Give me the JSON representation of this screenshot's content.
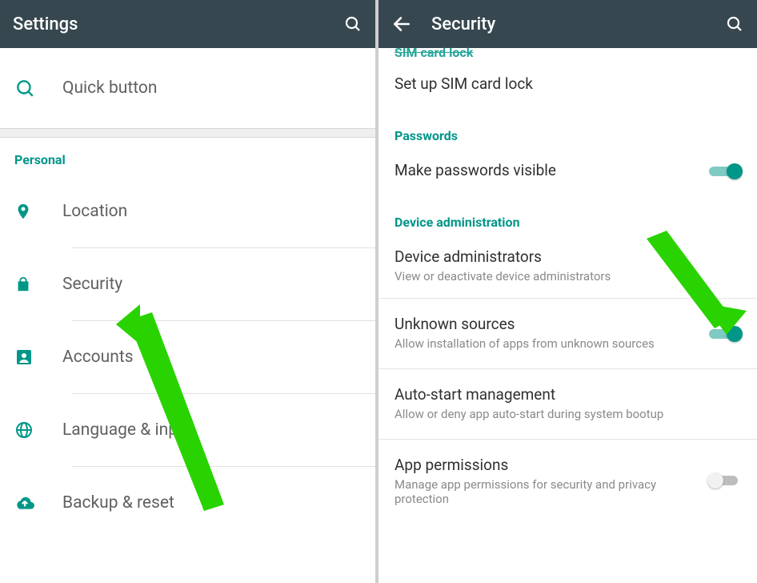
{
  "colors": {
    "accent": "#009688",
    "appbar": "#37474f",
    "arrow": "#29d301"
  },
  "left": {
    "title": "Settings",
    "quick": "Quick button",
    "personal_header": "Personal",
    "items": [
      {
        "icon": "location",
        "label": "Location"
      },
      {
        "icon": "lock",
        "label": "Security"
      },
      {
        "icon": "accounts",
        "label": "Accounts"
      },
      {
        "icon": "language",
        "label": "Language & input"
      },
      {
        "icon": "backup",
        "label": "Backup & reset"
      }
    ]
  },
  "right": {
    "title": "Security",
    "cutoff_header": "SIM card lock",
    "sim_item": "Set up SIM card lock",
    "passwords_header": "Passwords",
    "passwords_item": "Make passwords visible",
    "device_admin_header": "Device administration",
    "device_admin_title": "Device administrators",
    "device_admin_sub": "View or deactivate device administrators",
    "unknown_title": "Unknown sources",
    "unknown_sub": "Allow installation of apps from unknown sources",
    "autostart_title": "Auto-start management",
    "autostart_sub": "Allow or deny app auto-start during system bootup",
    "perm_title": "App permissions",
    "perm_sub": "Manage app permissions for security and privacy protection"
  }
}
